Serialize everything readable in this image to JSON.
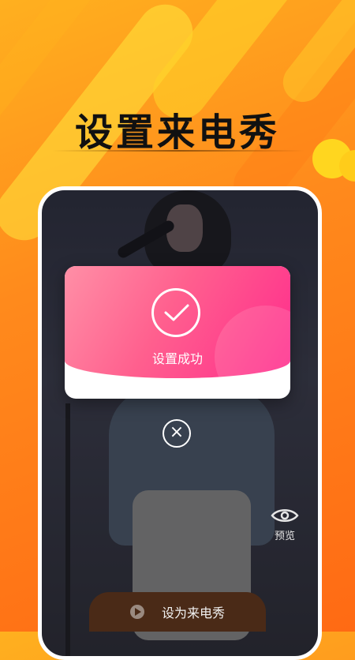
{
  "headline": "设置来电秀",
  "dialog": {
    "message": "设置成功"
  },
  "close_glyph": "×",
  "preview": {
    "label": "预览"
  },
  "cta": {
    "label": "设为来电秀"
  },
  "colors": {
    "accent_orange": "#ff8a1c",
    "dialog_pink": "#ff2b8c",
    "cta_brown": "#4a2a17"
  },
  "icons": {
    "success": "check-icon",
    "close": "close-icon",
    "preview": "eye-icon",
    "play": "play-icon"
  }
}
